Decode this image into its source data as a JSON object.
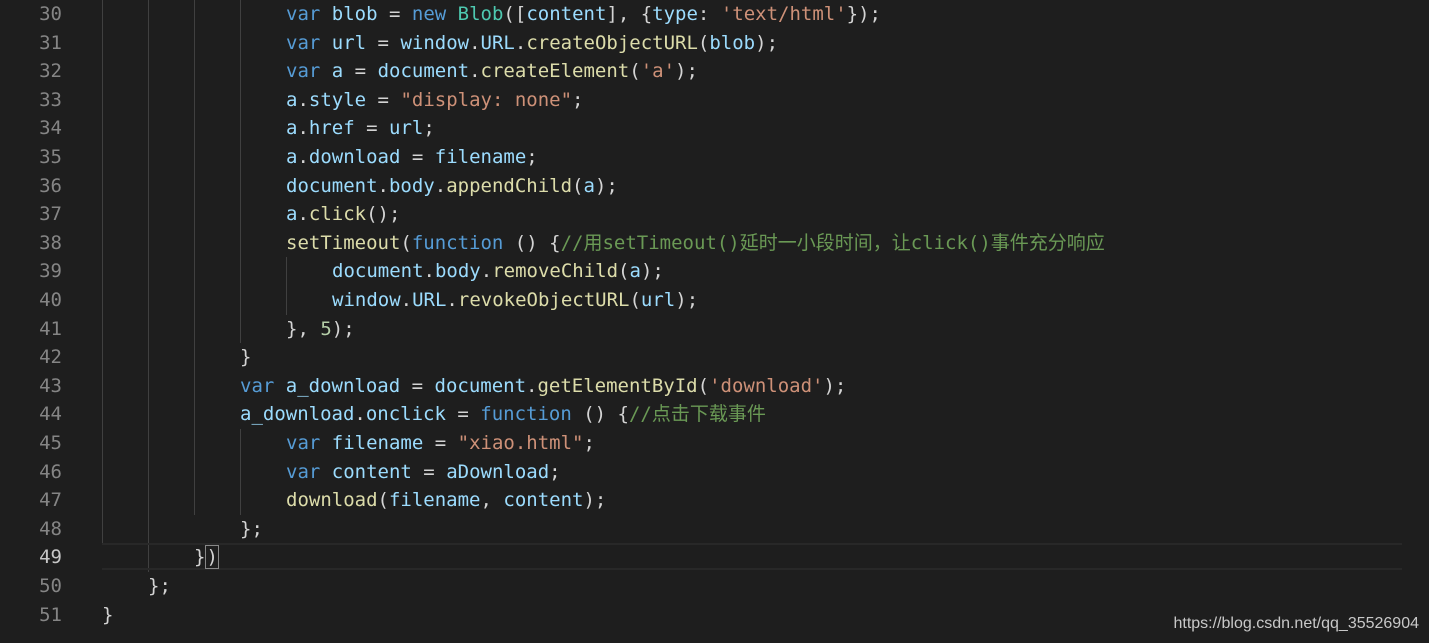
{
  "editor": {
    "active_line": "49",
    "lines": [
      {
        "num": "30",
        "tokens": [
          [
            "kw",
            "var"
          ],
          [
            "pun",
            " "
          ],
          [
            "var",
            "blob"
          ],
          [
            "pun",
            " = "
          ],
          [
            "kw",
            "new"
          ],
          [
            "pun",
            " "
          ],
          [
            "cls",
            "Blob"
          ],
          [
            "pun",
            "(["
          ],
          [
            "var",
            "content"
          ],
          [
            "pun",
            "], {"
          ],
          [
            "var",
            "type"
          ],
          [
            "pun",
            ": "
          ],
          [
            "str",
            "'text/html'"
          ],
          [
            "pun",
            "});"
          ]
        ]
      },
      {
        "num": "31",
        "tokens": [
          [
            "kw",
            "var"
          ],
          [
            "pun",
            " "
          ],
          [
            "var",
            "url"
          ],
          [
            "pun",
            " = "
          ],
          [
            "var",
            "window"
          ],
          [
            "pun",
            "."
          ],
          [
            "var",
            "URL"
          ],
          [
            "pun",
            "."
          ],
          [
            "fn",
            "createObjectURL"
          ],
          [
            "pun",
            "("
          ],
          [
            "var",
            "blob"
          ],
          [
            "pun",
            ");"
          ]
        ]
      },
      {
        "num": "32",
        "tokens": [
          [
            "kw",
            "var"
          ],
          [
            "pun",
            " "
          ],
          [
            "var",
            "a"
          ],
          [
            "pun",
            " = "
          ],
          [
            "var",
            "document"
          ],
          [
            "pun",
            "."
          ],
          [
            "fn",
            "createElement"
          ],
          [
            "pun",
            "("
          ],
          [
            "str",
            "'a'"
          ],
          [
            "pun",
            ");"
          ]
        ]
      },
      {
        "num": "33",
        "tokens": [
          [
            "var",
            "a"
          ],
          [
            "pun",
            "."
          ],
          [
            "var",
            "style"
          ],
          [
            "pun",
            " = "
          ],
          [
            "str",
            "\"display: none\""
          ],
          [
            "pun",
            ";"
          ]
        ]
      },
      {
        "num": "34",
        "tokens": [
          [
            "var",
            "a"
          ],
          [
            "pun",
            "."
          ],
          [
            "var",
            "href"
          ],
          [
            "pun",
            " = "
          ],
          [
            "var",
            "url"
          ],
          [
            "pun",
            ";"
          ]
        ]
      },
      {
        "num": "35",
        "tokens": [
          [
            "var",
            "a"
          ],
          [
            "pun",
            "."
          ],
          [
            "var",
            "download"
          ],
          [
            "pun",
            " = "
          ],
          [
            "var",
            "filename"
          ],
          [
            "pun",
            ";"
          ]
        ]
      },
      {
        "num": "36",
        "tokens": [
          [
            "var",
            "document"
          ],
          [
            "pun",
            "."
          ],
          [
            "var",
            "body"
          ],
          [
            "pun",
            "."
          ],
          [
            "fn",
            "appendChild"
          ],
          [
            "pun",
            "("
          ],
          [
            "var",
            "a"
          ],
          [
            "pun",
            ");"
          ]
        ]
      },
      {
        "num": "37",
        "tokens": [
          [
            "var",
            "a"
          ],
          [
            "pun",
            "."
          ],
          [
            "fn",
            "click"
          ],
          [
            "pun",
            "();"
          ]
        ]
      },
      {
        "num": "38",
        "tokens": [
          [
            "fn",
            "setTimeout"
          ],
          [
            "pun",
            "("
          ],
          [
            "kw",
            "function"
          ],
          [
            "pun",
            " () {"
          ],
          [
            "cmt",
            "//用setTimeout()延时一小段时间，让click()事件充分响应"
          ]
        ]
      },
      {
        "num": "39",
        "tokens": [
          [
            "var",
            "document"
          ],
          [
            "pun",
            "."
          ],
          [
            "var",
            "body"
          ],
          [
            "pun",
            "."
          ],
          [
            "fn",
            "removeChild"
          ],
          [
            "pun",
            "("
          ],
          [
            "var",
            "a"
          ],
          [
            "pun",
            ");"
          ]
        ]
      },
      {
        "num": "40",
        "tokens": [
          [
            "var",
            "window"
          ],
          [
            "pun",
            "."
          ],
          [
            "var",
            "URL"
          ],
          [
            "pun",
            "."
          ],
          [
            "fn",
            "revokeObjectURL"
          ],
          [
            "pun",
            "("
          ],
          [
            "var",
            "url"
          ],
          [
            "pun",
            ");"
          ]
        ]
      },
      {
        "num": "41",
        "tokens": [
          [
            "pun",
            "}, "
          ],
          [
            "num",
            "5"
          ],
          [
            "pun",
            ");"
          ]
        ]
      },
      {
        "num": "42",
        "tokens": [
          [
            "pun",
            "}"
          ]
        ]
      },
      {
        "num": "43",
        "tokens": [
          [
            "kw",
            "var"
          ],
          [
            "pun",
            " "
          ],
          [
            "var",
            "a_download"
          ],
          [
            "pun",
            " = "
          ],
          [
            "var",
            "document"
          ],
          [
            "pun",
            "."
          ],
          [
            "fn",
            "getElementById"
          ],
          [
            "pun",
            "("
          ],
          [
            "str",
            "'download'"
          ],
          [
            "pun",
            ");"
          ]
        ]
      },
      {
        "num": "44",
        "tokens": [
          [
            "var",
            "a_download"
          ],
          [
            "pun",
            "."
          ],
          [
            "var",
            "onclick"
          ],
          [
            "pun",
            " = "
          ],
          [
            "kw",
            "function"
          ],
          [
            "pun",
            " () {"
          ],
          [
            "cmt",
            "//点击下载事件"
          ]
        ]
      },
      {
        "num": "45",
        "tokens": [
          [
            "kw",
            "var"
          ],
          [
            "pun",
            " "
          ],
          [
            "var",
            "filename"
          ],
          [
            "pun",
            " = "
          ],
          [
            "str",
            "\"xiao.html\""
          ],
          [
            "pun",
            ";"
          ]
        ]
      },
      {
        "num": "46",
        "tokens": [
          [
            "kw",
            "var"
          ],
          [
            "pun",
            " "
          ],
          [
            "var",
            "content"
          ],
          [
            "pun",
            " = "
          ],
          [
            "var",
            "aDownload"
          ],
          [
            "pun",
            ";"
          ]
        ]
      },
      {
        "num": "47",
        "tokens": [
          [
            "fn",
            "download"
          ],
          [
            "pun",
            "("
          ],
          [
            "var",
            "filename"
          ],
          [
            "pun",
            ", "
          ],
          [
            "var",
            "content"
          ],
          [
            "pun",
            ");"
          ]
        ]
      },
      {
        "num": "48",
        "tokens": [
          [
            "pun",
            "};"
          ]
        ]
      },
      {
        "num": "49",
        "tokens": [
          [
            "pun",
            "}"
          ],
          [
            "bracket",
            ")"
          ]
        ]
      },
      {
        "num": "50",
        "tokens": [
          [
            "pun",
            "};"
          ]
        ]
      },
      {
        "num": "51",
        "tokens": [
          [
            "pun",
            "}"
          ]
        ]
      }
    ]
  },
  "watermark": "https://blog.csdn.net/qq_35526904",
  "colors": {
    "background": "#1e1e1e",
    "keyword": "#569cd6",
    "variable": "#9cdcfe",
    "function": "#dcdcaa",
    "class": "#4ec9b0",
    "string": "#ce9178",
    "number": "#b5cea8",
    "comment": "#6a9955"
  }
}
